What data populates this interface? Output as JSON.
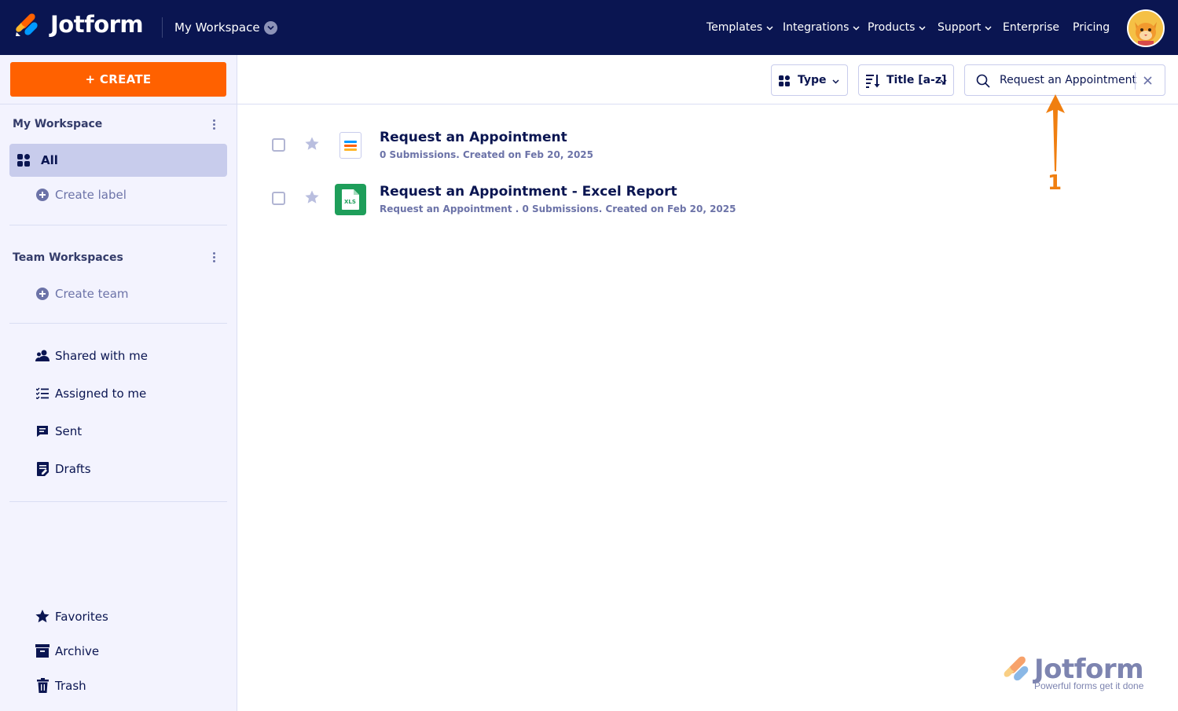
{
  "header": {
    "brand": "Jotform",
    "workspace_label": "My Workspace",
    "nav": [
      {
        "label": "Templates",
        "dropdown": true
      },
      {
        "label": "Integrations",
        "dropdown": true
      },
      {
        "label": "Products",
        "dropdown": true
      },
      {
        "label": "Support",
        "dropdown": true
      },
      {
        "label": "Enterprise",
        "dropdown": false
      },
      {
        "label": "Pricing",
        "dropdown": false
      }
    ],
    "avatar_icon": "user-avatar-cat-icon"
  },
  "sidebar": {
    "create_label": "+ CREATE",
    "my_workspace_title": "My Workspace",
    "all_label": "All",
    "create_label_link": "Create label",
    "team_workspaces_title": "Team Workspaces",
    "create_team_link": "Create team",
    "items": [
      {
        "label": "Shared with me",
        "icon": "shared-users-icon"
      },
      {
        "label": "Assigned to me",
        "icon": "checklist-icon"
      },
      {
        "label": "Sent",
        "icon": "message-icon"
      },
      {
        "label": "Drafts",
        "icon": "draft-icon"
      }
    ],
    "bottom_items": [
      {
        "label": "Favorites",
        "icon": "star-icon"
      },
      {
        "label": "Archive",
        "icon": "archive-icon"
      },
      {
        "label": "Trash",
        "icon": "trash-icon"
      }
    ]
  },
  "toolbar": {
    "type_label": "Type",
    "sort_label": "Title [a-z]",
    "search_value": "Request an Appointment"
  },
  "list": [
    {
      "title": "Request an Appointment",
      "subtitle": "0 Submissions. Created on Feb 20, 2025",
      "icon": "form-icon"
    },
    {
      "title": "Request an Appointment - Excel Report",
      "subtitle": "Request an Appointment . 0 Submissions. Created on Feb 20, 2025",
      "icon": "xls-report-icon",
      "icon_text": "XLS"
    }
  ],
  "annotation": {
    "number": "1",
    "color": "#f07f10"
  },
  "watermark": {
    "brand": "Jotform",
    "tagline": "Powerful forms get it done"
  },
  "colors": {
    "navy": "#0a1551",
    "orange": "#ff6100",
    "sidebar_bg": "#f3f3fe",
    "active_bg": "#c8ccec",
    "xls_green": "#1e9e5a"
  }
}
